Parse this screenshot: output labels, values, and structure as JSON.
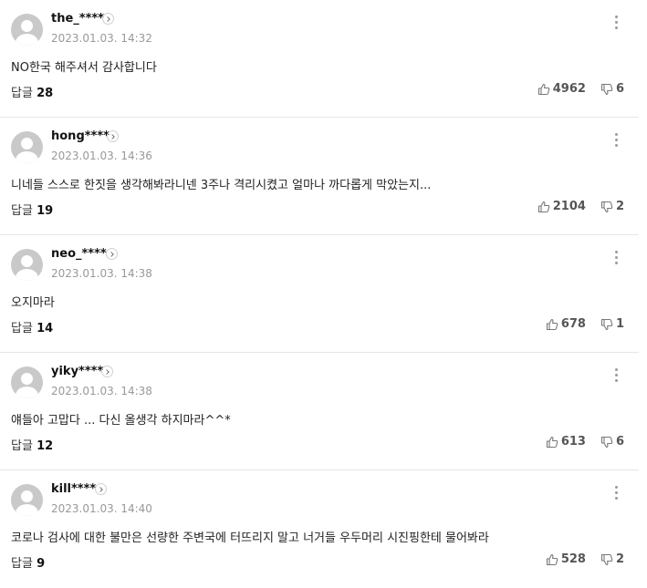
{
  "comments": [
    {
      "username": "the_****",
      "timestamp": "2023.01.03. 14:32",
      "text": "NO한국 해주셔서 감사합니다",
      "reply_label": "답글",
      "reply_count": "28",
      "likes": "4962",
      "dislikes": "6"
    },
    {
      "username": "hong****",
      "timestamp": "2023.01.03. 14:36",
      "text": "니네들 스스로 한짓을 생각해봐라니넨 3주나 격리시켰고 얼마나 까다롭게 막았는지...",
      "reply_label": "답글",
      "reply_count": "19",
      "likes": "2104",
      "dislikes": "2"
    },
    {
      "username": "neo_****",
      "timestamp": "2023.01.03. 14:38",
      "text": "오지마라",
      "reply_label": "답글",
      "reply_count": "14",
      "likes": "678",
      "dislikes": "1"
    },
    {
      "username": "yiky****",
      "timestamp": "2023.01.03. 14:38",
      "text": "얘들아 고맙다 ... 다신 올생각 하지마라^^*",
      "reply_label": "답글",
      "reply_count": "12",
      "likes": "613",
      "dislikes": "6"
    },
    {
      "username": "kill****",
      "timestamp": "2023.01.03. 14:40",
      "text": "코로나 검사에 대한 불만은 선량한 주변국에 터뜨리지 말고 너거들 우두머리 시진핑한테 물어봐라",
      "reply_label": "답글",
      "reply_count": "9",
      "likes": "528",
      "dislikes": "2"
    }
  ],
  "icons": {
    "avatar": "default-user-avatar",
    "profile": "chevron-right-icon",
    "more": "more-vertical-icon",
    "like": "thumbs-up-icon",
    "dislike": "thumbs-down-icon"
  }
}
